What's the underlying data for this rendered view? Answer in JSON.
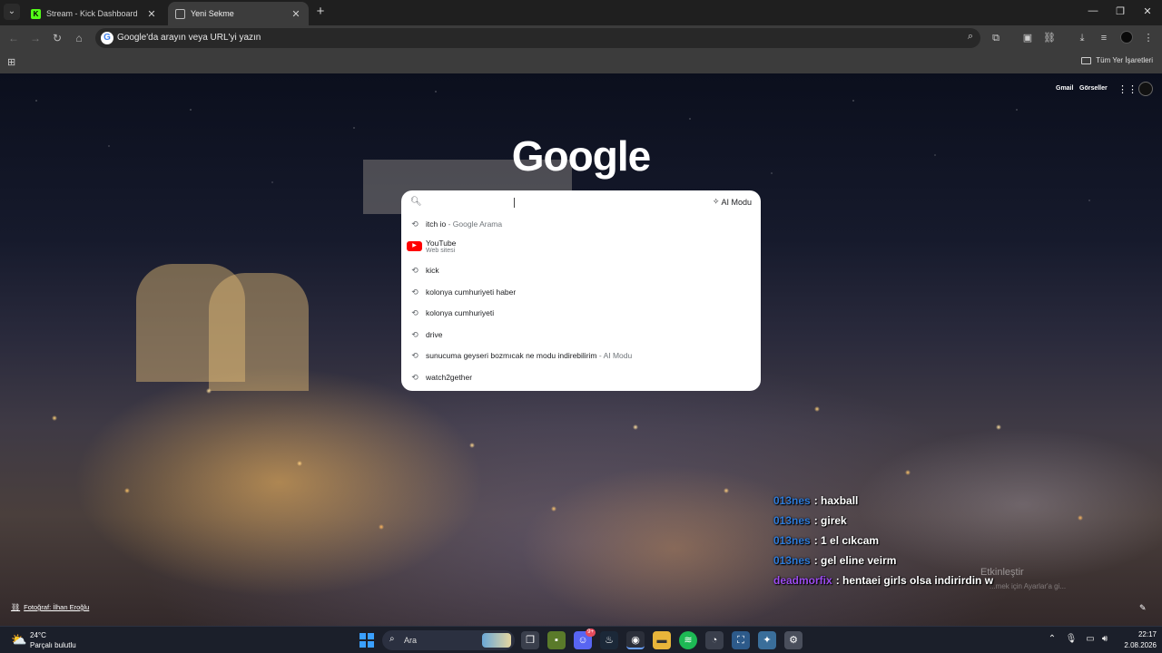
{
  "browser": {
    "tabs": [
      {
        "title": "Stream - Kick Dashboard",
        "favicon": "kick-icon",
        "active": false
      },
      {
        "title": "Yeni Sekme",
        "favicon": "globe-icon",
        "active": true
      }
    ],
    "new_tab_symbol": "+",
    "window_controls": {
      "minimize": "—",
      "restore": "❐",
      "close": "✕"
    },
    "omnibox": {
      "text": "Google'da arayın veya URL'yi yazın",
      "badge": "G"
    },
    "bookmarks": {
      "all_bookmarks_label": "Tüm Yer İşaretleri"
    }
  },
  "ntp": {
    "logo": "Google",
    "top_links": {
      "gmail": "Gmail",
      "images": "Görseller"
    },
    "search": {
      "value": "",
      "placeholder": "",
      "ai_mode_label": "AI Modu",
      "suggestions": [
        {
          "text": "itch io",
          "suffix": " - Google Arama",
          "icon": "history-icon"
        },
        {
          "title": "YouTube",
          "subtitle": "Web sitesi",
          "icon": "youtube-icon"
        },
        {
          "text": "kick",
          "suffix": "",
          "icon": "history-icon"
        },
        {
          "text": "kolonya cumhuriyeti haber",
          "suffix": "",
          "icon": "history-icon"
        },
        {
          "text": "kolonya cumhuriyeti",
          "suffix": "",
          "icon": "history-icon"
        },
        {
          "text": "drive",
          "suffix": "",
          "icon": "history-icon"
        },
        {
          "text": "sunucuma geyseri bozmıcak ne modu indirebilirim",
          "suffix": " - AI Modu",
          "icon": "history-icon"
        },
        {
          "text": "watch2gether",
          "suffix": "",
          "icon": "history-icon"
        }
      ]
    },
    "photo_credit": "Fotoğraf: İlhan Eroğlu"
  },
  "chat": {
    "messages": [
      {
        "user": "013nes",
        "text": ": haxball",
        "color": "#2f7bd8"
      },
      {
        "user": "013nes",
        "text": ": girek",
        "color": "#2f7bd8"
      },
      {
        "user": "013nes",
        "text": ": 1 el cıkcam",
        "color": "#2f7bd8"
      },
      {
        "user": "013nes",
        "text": ": gel eline veirm",
        "color": "#2f7bd8"
      },
      {
        "user": "deadmorfix",
        "text": ": hentaei girls olsa indirirdin w",
        "color": "#9d4cf0"
      }
    ],
    "watermark_line1": "Etkinleştir",
    "watermark_line2": "...mek için Ayarlar'a gi..."
  },
  "taskbar": {
    "weather": {
      "temp": "24°C",
      "desc": "Parçalı bulutlu"
    },
    "search_label": "Ara",
    "discord_badge": "9+",
    "clock": {
      "time": "22:17",
      "date": "2.08.2026"
    }
  }
}
